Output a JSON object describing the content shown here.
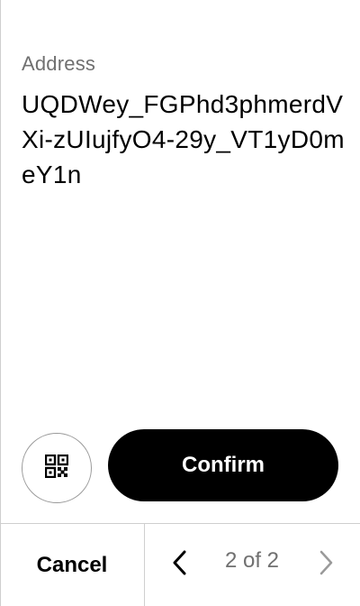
{
  "address": {
    "label": "Address",
    "value": "UQDWey_FGPhd3phmerdVXi-zUIujfyO4-29y_VT1yD0meY1n"
  },
  "actions": {
    "confirm_label": "Confirm",
    "qr_icon": "qr-code-icon"
  },
  "footer": {
    "cancel_label": "Cancel",
    "page_indicator": "2 of 2",
    "prev_icon": "chevron-left-icon",
    "next_icon": "chevron-right-icon",
    "next_disabled": true
  },
  "colors": {
    "text_primary": "#000000",
    "text_secondary": "#707070",
    "button_primary_bg": "#000000",
    "button_primary_text": "#ffffff",
    "divider": "#cfcfcf",
    "disabled_icon": "#9a9a9a"
  }
}
